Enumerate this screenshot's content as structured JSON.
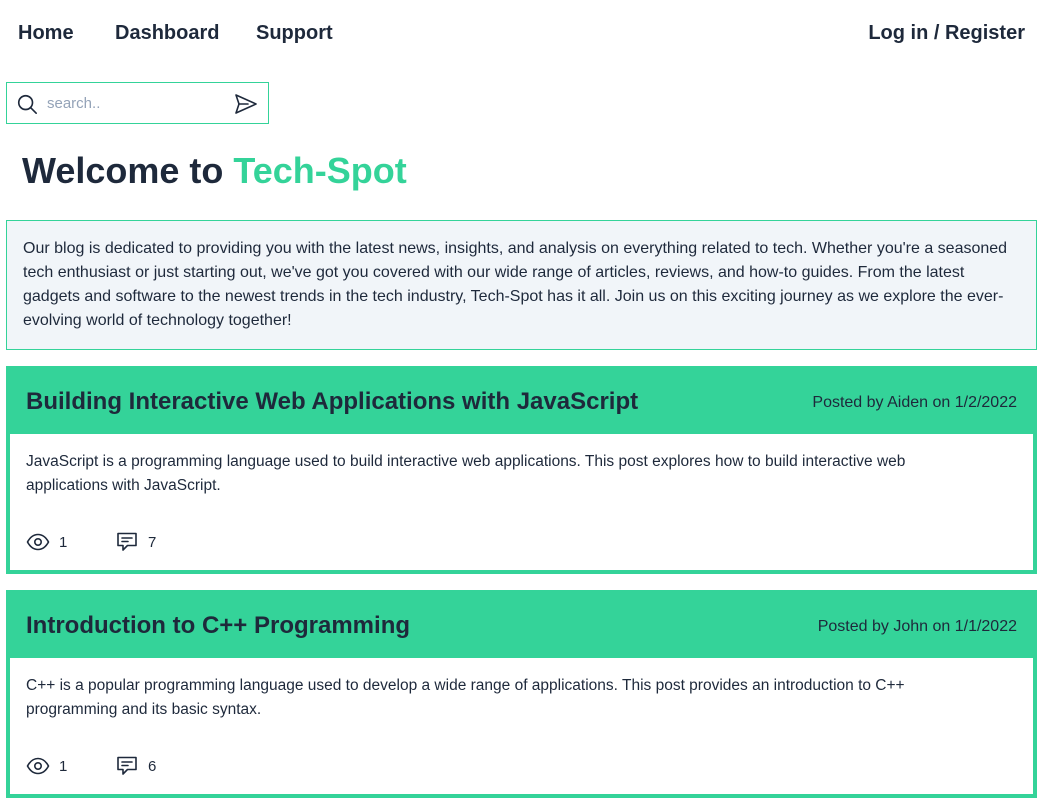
{
  "nav": {
    "home": "Home",
    "dashboard": "Dashboard",
    "support": "Support",
    "login": "Log in / Register"
  },
  "search": {
    "placeholder": "search..",
    "value": ""
  },
  "hero": {
    "prefix": "Welcome to ",
    "brand": "Tech-Spot"
  },
  "intro": {
    "text": "Our blog is dedicated to providing you with the latest news, insights, and analysis on everything related to tech. Whether you're a seasoned tech enthusiast or just starting out, we've got you covered with our wide range of articles, reviews, and how-to guides. From the latest gadgets and software to the newest trends in the tech industry, Tech-Spot has it all. Join us on this exciting journey as we explore the ever-evolving world of technology together!"
  },
  "posts": [
    {
      "title": "Building Interactive Web Applications with JavaScript",
      "meta": "Posted by Aiden on 1/2/2022",
      "excerpt": "JavaScript is a programming language used to build interactive web applications. This post explores how to build interactive web applications with JavaScript.",
      "views": "1",
      "comments": "7"
    },
    {
      "title": "Introduction to C++ Programming",
      "meta": "Posted by John on 1/1/2022",
      "excerpt": "C++ is a popular programming language used to develop a wide range of applications. This post provides an introduction to C++ programming and its basic syntax.",
      "views": "1",
      "comments": "6"
    }
  ],
  "icons": {
    "search": "search-icon",
    "send": "send-icon",
    "views": "eye-icon",
    "comments": "comment-icon"
  },
  "colors": {
    "accent": "#34d399",
    "text": "#1e293b",
    "intro_bg": "#f1f5f9"
  }
}
